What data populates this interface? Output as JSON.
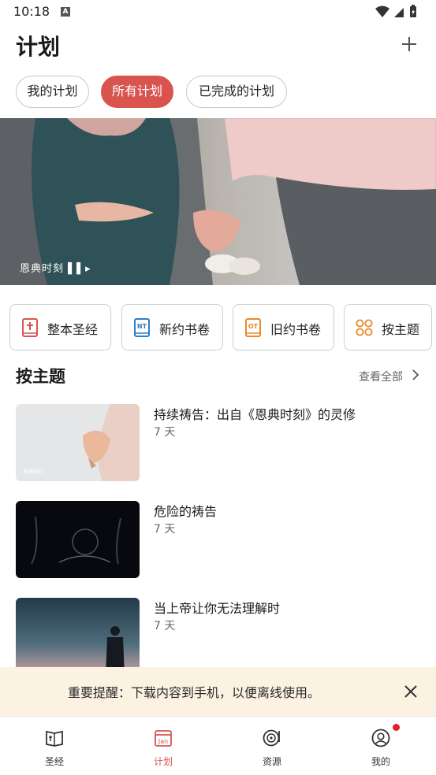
{
  "status_bar": {
    "time": "10:18",
    "a_badge": "A"
  },
  "header": {
    "title": "计划"
  },
  "filters": [
    {
      "label": "我的计划",
      "active": false
    },
    {
      "label": "所有计划",
      "active": true
    },
    {
      "label": "已完成的计划",
      "active": false
    }
  ],
  "hero": {
    "brand_label": "恩典时刻",
    "slide_count": 2,
    "active_slide": 1
  },
  "categories": [
    {
      "label": "整本圣经",
      "icon": "bible-icon",
      "badge": ""
    },
    {
      "label": "新约书卷",
      "icon": "new-testament-icon",
      "badge": "NT"
    },
    {
      "label": "旧约书卷",
      "icon": "old-testament-icon",
      "badge": "OT"
    },
    {
      "label": "按主题",
      "icon": "topics-grid-icon",
      "badge": ""
    }
  ],
  "section": {
    "title": "按主题",
    "see_all": "查看全部"
  },
  "plans": [
    {
      "title": "持续祷告：出自《恩典时刻》的灵修",
      "days": "7 天",
      "thumb_label": "恩典时刻"
    },
    {
      "title": "危险的祷告",
      "days": "7 天"
    },
    {
      "title": "当上帝让你无法理解时",
      "days": "7 天"
    }
  ],
  "banner": {
    "text": "重要提醒：下载内容到手机，以便离线使用。"
  },
  "bottom_nav": [
    {
      "label": "圣经",
      "icon": "bible-book-icon",
      "active": false
    },
    {
      "label": "计划",
      "icon": "calendar-icon",
      "active": true,
      "icon_text": "Jan"
    },
    {
      "label": "资源",
      "icon": "resources-disc-icon",
      "active": false
    },
    {
      "label": "我的",
      "icon": "profile-icon",
      "active": false,
      "notification": true
    }
  ],
  "colors": {
    "accent": "#d9534f",
    "banner_bg": "#fbf2e2",
    "nt_blue": "#2a7fc9",
    "ot_orange": "#ea8a2a"
  }
}
